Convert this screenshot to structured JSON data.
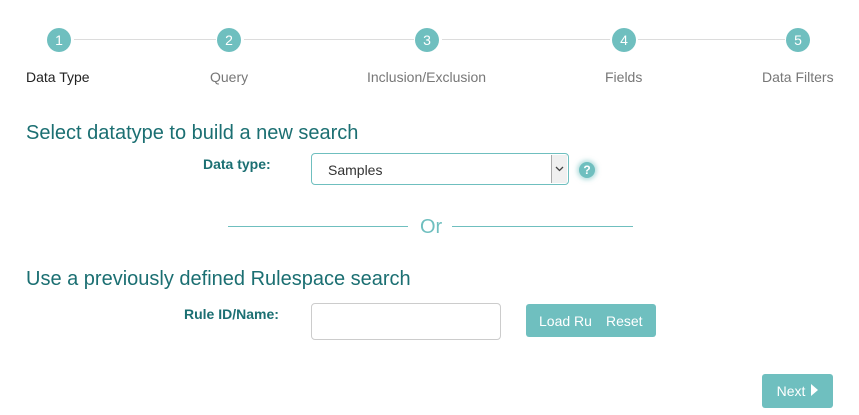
{
  "stepper": {
    "steps": [
      {
        "number": "1",
        "label": "Data Type"
      },
      {
        "number": "2",
        "label": "Query"
      },
      {
        "number": "3",
        "label": "Inclusion/Exclusion"
      },
      {
        "number": "4",
        "label": "Fields"
      },
      {
        "number": "5",
        "label": "Data Filters"
      }
    ],
    "active_step": "1"
  },
  "datatype_section": {
    "title": "Select datatype to build a new search",
    "label": "Data type:",
    "selected": "Samples",
    "help": "?"
  },
  "divider": {
    "text": "Or"
  },
  "rulespace_section": {
    "title": "Use a previously defined Rulespace search",
    "label": "Rule ID/Name:",
    "input_value": "",
    "load_label": "Load Ru",
    "reset_label": "Reset"
  },
  "footer": {
    "next_label": "Next"
  },
  "colors": {
    "accent": "#6fbfbf",
    "title": "#1b6f72"
  }
}
